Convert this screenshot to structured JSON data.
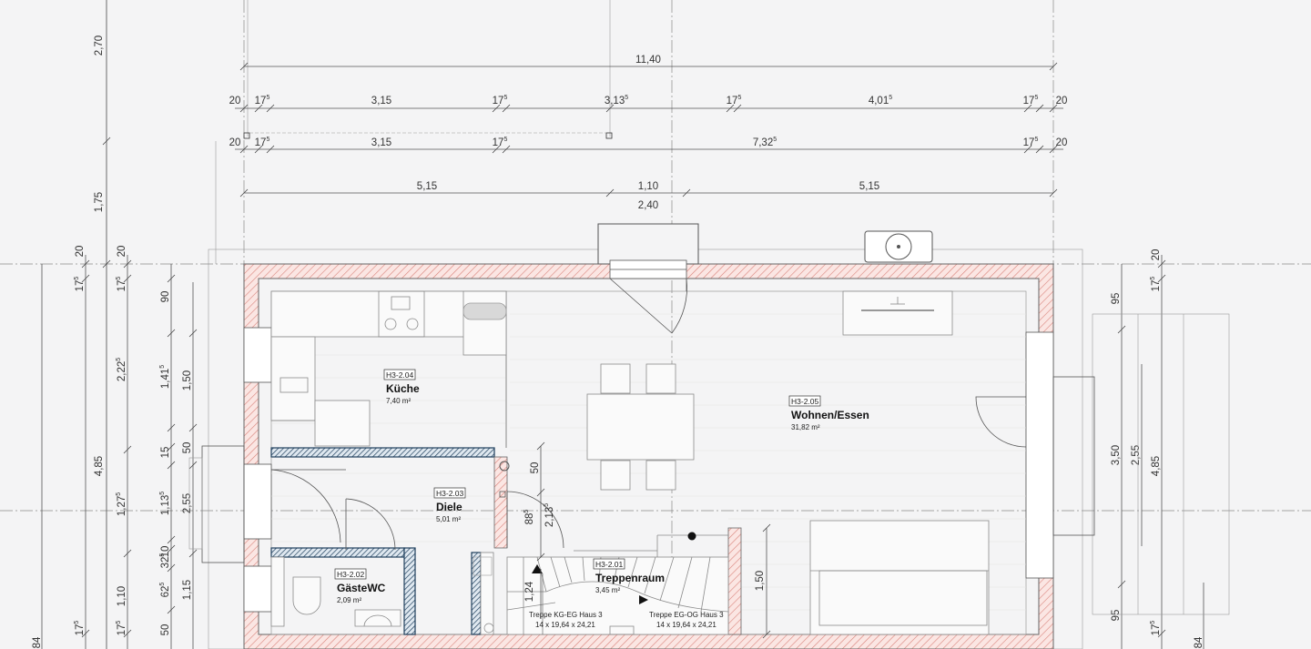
{
  "dimensions": {
    "top_overall": "11,40",
    "row1": {
      "d1": "20",
      "d2": "17",
      "d2s": "5",
      "d3": "3,15",
      "d4": "17",
      "d4s": "5",
      "d5": "3,13",
      "d5s": "5",
      "d6": "17",
      "d6s": "5",
      "d7": "4,01",
      "d7s": "5",
      "d8": "17",
      "d8s": "5",
      "d9": "20"
    },
    "row2": {
      "d1": "20",
      "d2": "17",
      "d2s": "5",
      "d3": "3,15",
      "d4": "17",
      "d4s": "5",
      "d5": "7,32",
      "d5s": "5",
      "d6": "17",
      "d6s": "5",
      "d7": "20"
    },
    "row3": {
      "d1": "5,15",
      "d2": "1,10",
      "d3": "5,15"
    },
    "row4": {
      "d1": "2,40"
    },
    "left_vertical_a": {
      "v1": "2,70",
      "v2": "1,75",
      "v3": "4,85",
      "v4": "84"
    },
    "left_vertical_b": {
      "v1": "20",
      "v2": "17",
      "v2s": "5",
      "v3": "17",
      "v3s": "5"
    },
    "left_vertical_c": {
      "v1": "20",
      "v2": "17",
      "v2s": "5",
      "v3": "2,22",
      "v3s": "5",
      "v4": "1,27",
      "v4s": "5",
      "v5": "1,10",
      "v6": "17",
      "v6s": "5"
    },
    "left_vertical_d": {
      "v1": "90",
      "v2": "1,41",
      "v2s": "5",
      "v3": "15",
      "v4": "1,13",
      "v4s": "5",
      "v5": "10",
      "v6": "32",
      "v6s": "5",
      "v7": "62",
      "v7s": "5",
      "v8": "50"
    },
    "left_vertical_e": {
      "v1": "1,50",
      "v2": "50",
      "v3": "2,55",
      "v4": "1,15"
    },
    "right_vertical": {
      "v1": "95",
      "v2": "3,50",
      "v3": "95",
      "v4": "20",
      "v5": "17",
      "v5s": "5",
      "v6": "2,55",
      "v7": "4,85",
      "v8": "17",
      "v8s": "5",
      "v9": "84"
    },
    "inner": {
      "a": "50",
      "b": "88",
      "bs": "5",
      "c": "2,13",
      "cs": "5",
      "d": "1,24",
      "e": "1,50"
    }
  },
  "rooms": [
    {
      "id": "H3-2.04",
      "name": "Küche",
      "area": "7,40 m²"
    },
    {
      "id": "H3-2.05",
      "name": "Wohnen/Essen",
      "area": "31,82 m²"
    },
    {
      "id": "H3-2.03",
      "name": "Diele",
      "area": "5,01 m²"
    },
    {
      "id": "H3-2.02",
      "name": "GästeWC",
      "area": "2,09 m²"
    },
    {
      "id": "H3-2.01",
      "name": "Treppenraum",
      "area": "3,45 m²"
    }
  ],
  "stairs": {
    "left_title": "Treppe KG-EG Haus 3",
    "left_spec": "14 x 19,64 x 24,21",
    "right_title": "Treppe EG-OG Haus 3",
    "right_spec": "14 x 19,64 x 24,21"
  },
  "colors": {
    "wall_hatch": "#d9827a",
    "wall_fill": "#fbe6e3",
    "insulation": "#1f3f5c",
    "background": "#f4f4f5"
  }
}
